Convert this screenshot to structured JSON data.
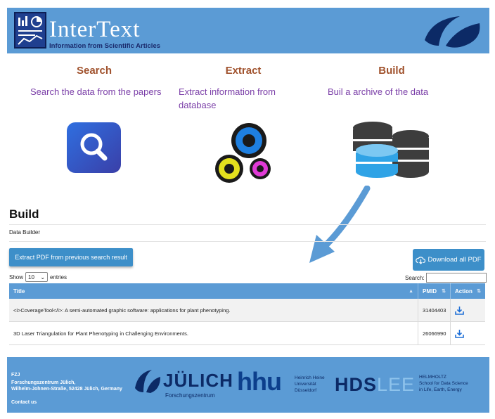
{
  "header": {
    "logo_title": "InterText",
    "logo_subtitle": "Information from Scientific Articles"
  },
  "features": [
    {
      "title": "Search",
      "description": "Search the data from the papers",
      "icon": "magnifier-icon"
    },
    {
      "title": "Extract",
      "description": "Extract information from database",
      "icon": "gears-icon"
    },
    {
      "title": "Build",
      "description": "Buil a archive of the data",
      "icon": "database-icon"
    }
  ],
  "build": {
    "title": "Build",
    "subtitle": "Data Builder",
    "extract_button": "Extract PDF from previous search result",
    "download_all_button": "Download all PDF",
    "show_label": "Show",
    "entries_value": "10",
    "entries_label": "entries",
    "search_label": "Search:",
    "search_value": ""
  },
  "table": {
    "columns": [
      "Title",
      "PMID",
      "Action"
    ],
    "rows": [
      {
        "title": "<i>CoverageTool</i>: A semi-automated graphic software: applications for plant phenotyping.",
        "pmid": "31404403"
      },
      {
        "title": "3D Laser Triangulation for Plant Phenotyping in Challenging Environments.",
        "pmid": "26066990"
      }
    ]
  },
  "footer": {
    "org_short": "FZJ",
    "org_name": "Forschungszentrum Jülich,",
    "address": "Wilhelm-Johnen-Straße, 52428 Jülich, Germany",
    "contact": "Contact us",
    "julich_word": "JÜLICH",
    "julich_sub": "Forschungszentrum",
    "hhu": "hhu",
    "hhu_line1": "Heinrich Heine",
    "hhu_line2": "Universität",
    "hhu_line3": "Düsseldorf",
    "hds_a": "HDS",
    "hds_b": "LEE",
    "helm_line1": "HELMHOLTZ",
    "helm_line2": "School for Data Science",
    "helm_line3": "in Life, Earth, Energy"
  },
  "colors": {
    "header_bg": "#5b9bd5",
    "feature_title": "#a0522d",
    "feature_text": "#7b3fa8",
    "button_bg": "#3d8fc9"
  }
}
